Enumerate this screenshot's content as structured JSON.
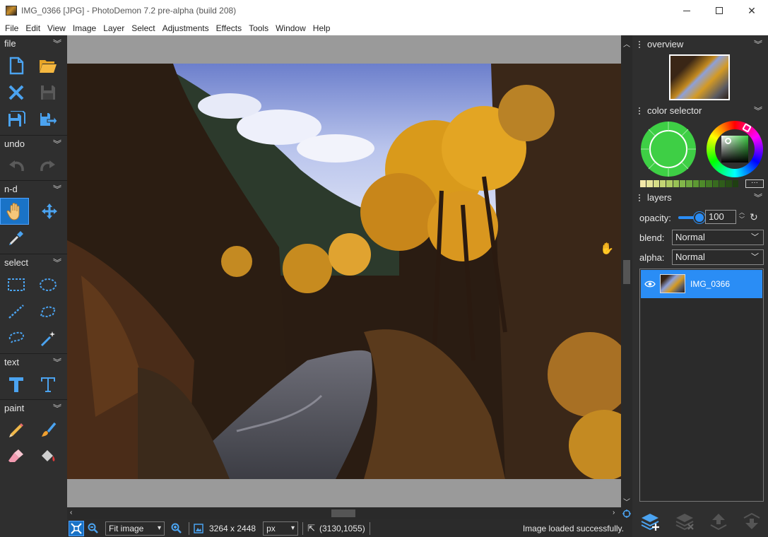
{
  "window": {
    "title": "IMG_0366 [JPG]  -  PhotoDemon 7.2 pre-alpha (build 208)",
    "minimize_icon": "minimize-icon",
    "maximize_icon": "maximize-icon",
    "close_glyph": "✕"
  },
  "menu": [
    "File",
    "Edit",
    "View",
    "Image",
    "Layer",
    "Select",
    "Adjustments",
    "Effects",
    "Tools",
    "Window",
    "Help"
  ],
  "toolbox": {
    "sections": {
      "file": "file",
      "undo": "undo",
      "nd": "n-d",
      "select": "select",
      "text": "text",
      "paint": "paint"
    },
    "active_tool": "hand-pan-icon",
    "accent": "#1a73c7"
  },
  "status_bar": {
    "zoom_option": "Fit image",
    "image_size": "3264 x 2448",
    "unit": "px",
    "cursor_pos": "(3130,1055)",
    "message": "Image loaded successfully."
  },
  "panels": {
    "overview": {
      "title": "overview"
    },
    "color_selector": {
      "title": "color selector",
      "primary_color": "#3ecf45",
      "palette_more": "···",
      "palette": [
        "#f2e7a8",
        "#e6e49a",
        "#d6dd87",
        "#c3d474",
        "#aecb63",
        "#98c155",
        "#82b64a",
        "#6ea83f",
        "#5d9933",
        "#4e8a2a",
        "#427a24",
        "#386b1f",
        "#2f5c1a",
        "#274d16",
        "#1f3f12"
      ]
    },
    "layers": {
      "title": "layers",
      "opacity_label": "opacity:",
      "opacity_value": "100",
      "opacity_fraction": 1.0,
      "blend_label": "blend:",
      "blend_value": "Normal",
      "alpha_label": "alpha:",
      "alpha_value": "Normal",
      "items": [
        {
          "name": "IMG_0366",
          "visible": true,
          "selected": true
        }
      ],
      "selection_color": "#2a8df5"
    }
  }
}
